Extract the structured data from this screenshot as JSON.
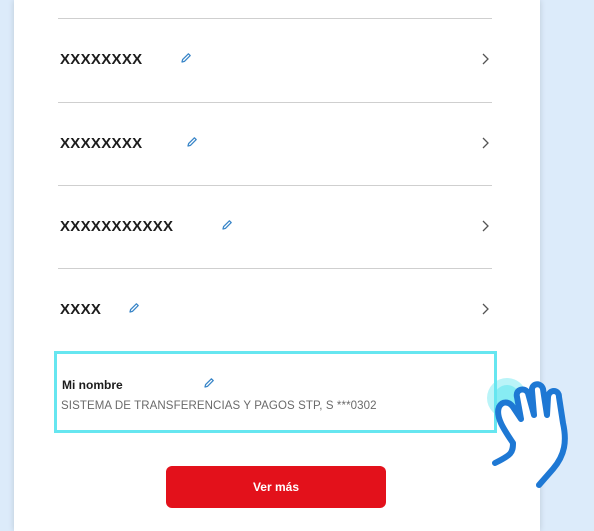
{
  "accounts": [
    {
      "label": "XXXXXXXX"
    },
    {
      "label": "XXXXXXXX"
    },
    {
      "label": "XXXXXXXXXXX"
    },
    {
      "label": "XXXX"
    }
  ],
  "selected_account": {
    "title": "Mi nombre",
    "subtitle": "SISTEMA DE TRANSFERENCIAS Y PAGOS STP, S ***0302"
  },
  "buttons": {
    "ver_mas": "Ver más"
  },
  "colors": {
    "accent": "#e3111b",
    "highlight": "#66e6f0",
    "edit_icon": "#3a86c8",
    "pointer": "#1e78d4"
  },
  "icons": {
    "edit": "pencil-icon",
    "navigate": "chevron-right-icon",
    "pointer": "tap-hand-icon"
  }
}
